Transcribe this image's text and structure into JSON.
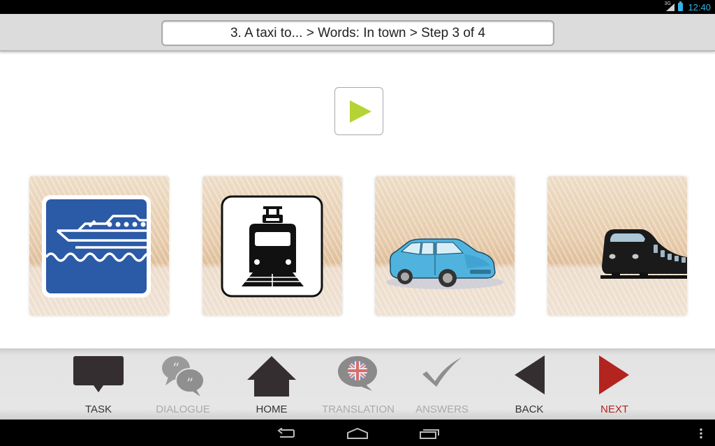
{
  "status_bar": {
    "network_type": "3G",
    "time": "12:40",
    "icons": [
      "signal-icon",
      "battery-icon"
    ]
  },
  "header": {
    "breadcrumb": "3. A taxi to... > Words: In town > Step 3 of 4"
  },
  "audio": {
    "play_icon": "play-icon",
    "play_color": "#b5d334"
  },
  "choices": [
    {
      "name": "ferry",
      "icon": "ferry-sign-icon"
    },
    {
      "name": "tram",
      "icon": "tram-sign-icon"
    },
    {
      "name": "car",
      "icon": "car-icon"
    },
    {
      "name": "train",
      "icon": "train-icon"
    }
  ],
  "toolbar": {
    "items": [
      {
        "id": "task",
        "label": "TASK",
        "icon": "speech-bubble-icon",
        "enabled": true
      },
      {
        "id": "dialogue",
        "label": "DIALOGUE",
        "icon": "dialogue-bubbles-icon",
        "enabled": false
      },
      {
        "id": "home",
        "label": "HOME",
        "icon": "home-icon",
        "enabled": true
      },
      {
        "id": "translation",
        "label": "TRANSLATION",
        "icon": "uk-flag-bubble-icon",
        "enabled": false
      },
      {
        "id": "answers",
        "label": "ANSWERS",
        "icon": "checkmark-icon",
        "enabled": false
      },
      {
        "id": "back",
        "label": "BACK",
        "icon": "back-arrow-icon",
        "enabled": true
      },
      {
        "id": "next",
        "label": "NEXT",
        "icon": "next-arrow-icon",
        "enabled": true
      }
    ],
    "colors": {
      "active": "#333333",
      "disabled": "#a9a9a9",
      "next": "#b3241f"
    }
  },
  "nav_bar": {
    "buttons": [
      "back-icon",
      "home-icon",
      "recent-apps-icon",
      "overflow-menu-icon"
    ]
  }
}
